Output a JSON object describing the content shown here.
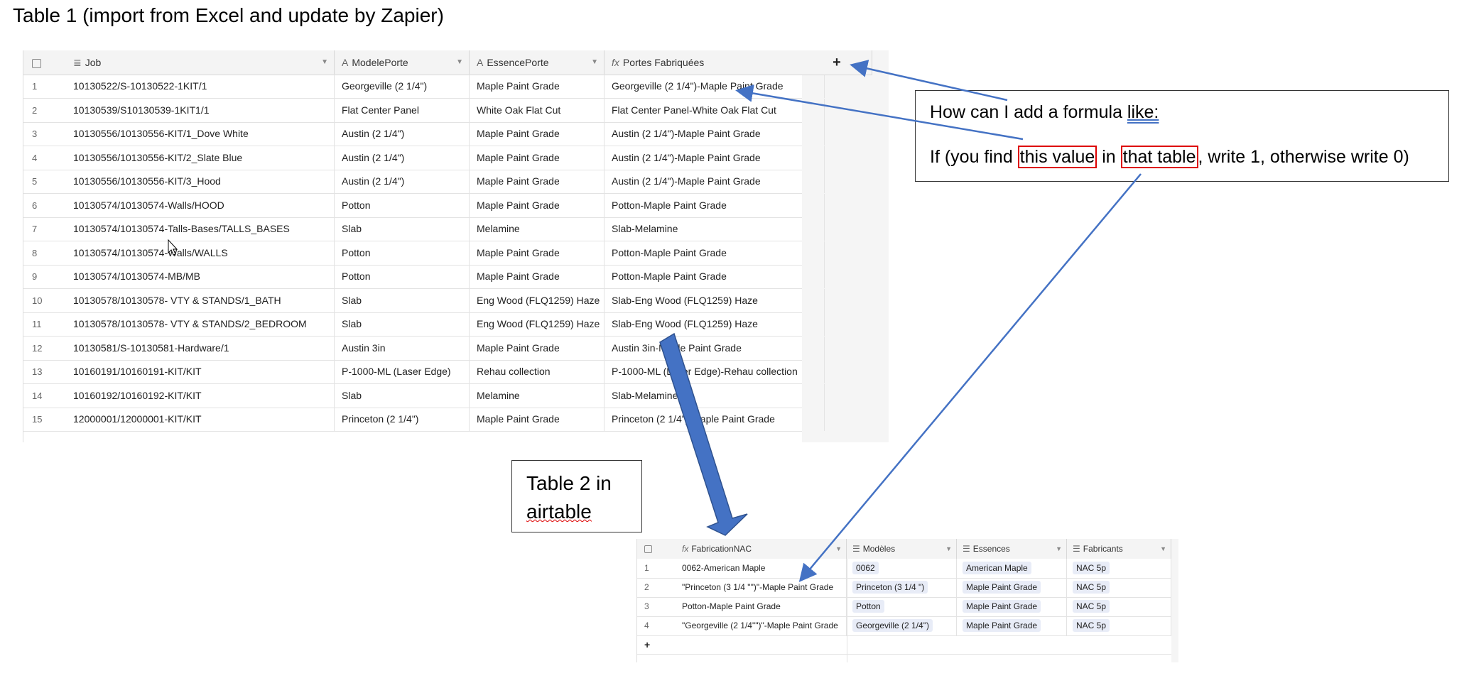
{
  "page_title": "Table 1 (import from Excel and update by Zapier)",
  "table1": {
    "columns": [
      {
        "icon": "≣",
        "label": "Job"
      },
      {
        "icon": "A",
        "label": "ModelePorte"
      },
      {
        "icon": "A",
        "label": "EssencePorte"
      },
      {
        "icon": "fx",
        "label": "Portes Fabriquées"
      }
    ],
    "add_column_label": "+",
    "rows": [
      {
        "n": "1",
        "job": "10130522/S-10130522-1KIT/1",
        "modele": "Georgeville (2 1/4\")",
        "essence": "Maple Paint Grade",
        "portes": "Georgeville (2 1/4\")-Maple Paint Grade"
      },
      {
        "n": "2",
        "job": "10130539/S10130539-1KIT1/1",
        "modele": "Flat Center Panel",
        "essence": "White Oak Flat Cut",
        "portes": "Flat Center Panel-White Oak Flat Cut"
      },
      {
        "n": "3",
        "job": "10130556/10130556-KIT/1_Dove White",
        "modele": "Austin (2 1/4\")",
        "essence": "Maple Paint Grade",
        "portes": "Austin (2 1/4\")-Maple Paint Grade"
      },
      {
        "n": "4",
        "job": "10130556/10130556-KIT/2_Slate Blue",
        "modele": "Austin (2 1/4\")",
        "essence": "Maple Paint Grade",
        "portes": "Austin (2 1/4\")-Maple Paint Grade"
      },
      {
        "n": "5",
        "job": "10130556/10130556-KIT/3_Hood",
        "modele": "Austin (2 1/4\")",
        "essence": "Maple Paint Grade",
        "portes": "Austin (2 1/4\")-Maple Paint Grade"
      },
      {
        "n": "6",
        "job": "10130574/10130574-Walls/HOOD",
        "modele": "Potton",
        "essence": "Maple Paint Grade",
        "portes": "Potton-Maple Paint Grade"
      },
      {
        "n": "7",
        "job": "10130574/10130574-Talls-Bases/TALLS_BASES",
        "modele": "Slab",
        "essence": "Melamine",
        "portes": "Slab-Melamine"
      },
      {
        "n": "8",
        "job": "10130574/10130574-Walls/WALLS",
        "modele": "Potton",
        "essence": "Maple Paint Grade",
        "portes": "Potton-Maple Paint Grade"
      },
      {
        "n": "9",
        "job": "10130574/10130574-MB/MB",
        "modele": "Potton",
        "essence": "Maple Paint Grade",
        "portes": "Potton-Maple Paint Grade"
      },
      {
        "n": "10",
        "job": "10130578/10130578- VTY & STANDS/1_BATH",
        "modele": "Slab",
        "essence": "Eng Wood (FLQ1259) Haze",
        "portes": "Slab-Eng Wood (FLQ1259) Haze"
      },
      {
        "n": "11",
        "job": "10130578/10130578- VTY & STANDS/2_BEDROOM",
        "modele": "Slab",
        "essence": "Eng Wood (FLQ1259) Haze",
        "portes": "Slab-Eng Wood (FLQ1259) Haze"
      },
      {
        "n": "12",
        "job": "10130581/S-10130581-Hardware/1",
        "modele": "Austin 3in",
        "essence": "Maple Paint Grade",
        "portes": "Austin 3in-Maple Paint Grade"
      },
      {
        "n": "13",
        "job": "10160191/10160191-KIT/KIT",
        "modele": "P-1000-ML (Laser Edge)",
        "essence": "Rehau collection",
        "portes": "P-1000-ML (Laser Edge)-Rehau collection"
      },
      {
        "n": "14",
        "job": "10160192/10160192-KIT/KIT",
        "modele": "Slab",
        "essence": "Melamine",
        "portes": "Slab-Melamine"
      },
      {
        "n": "15",
        "job": "12000001/12000001-KIT/KIT",
        "modele": "Princeton (2 1/4\")",
        "essence": "Maple Paint Grade",
        "portes": "Princeton (2 1/4\")-Maple Paint Grade"
      }
    ]
  },
  "callout1": {
    "line1_prefix": "How can I add a formula ",
    "line1_underlined": "like:",
    "line2_a": "If (you find ",
    "line2_box1": "this value",
    "line2_b": " in ",
    "line2_box2": "that table",
    "line2_c": ", write 1, otherwise write 0)"
  },
  "callout2": {
    "line1": "Table 2 in",
    "line2": "airtable"
  },
  "table2": {
    "columns": [
      {
        "icon": "fx",
        "label": "FabricationNAC"
      },
      {
        "icon": "☰",
        "label": "Modèles"
      },
      {
        "icon": "☰",
        "label": "Essences"
      },
      {
        "icon": "☰",
        "label": "Fabricants"
      }
    ],
    "rows": [
      {
        "n": "1",
        "fab": "0062-American Maple",
        "modele": "0062",
        "essence": "American Maple",
        "fabricant": "NAC 5p"
      },
      {
        "n": "2",
        "fab": "\"Princeton (3 1/4 \"\")\"-Maple Paint Grade",
        "modele": "Princeton (3 1/4 \")",
        "essence": "Maple Paint Grade",
        "fabricant": "NAC 5p"
      },
      {
        "n": "3",
        "fab": "Potton-Maple Paint Grade",
        "modele": "Potton",
        "essence": "Maple Paint Grade",
        "fabricant": "NAC 5p"
      },
      {
        "n": "4",
        "fab": "\"Georgeville (2 1/4\"\")\"-Maple Paint Grade",
        "modele": "Georgeville (2 1/4\")",
        "essence": "Maple Paint Grade",
        "fabricant": "NAC 5p"
      }
    ],
    "add_row_label": "+"
  },
  "colors": {
    "arrow": "#4472c4",
    "highlight_box": "#dd0000"
  }
}
